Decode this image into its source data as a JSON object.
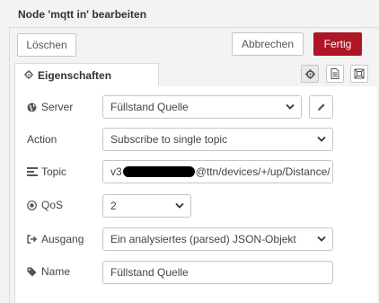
{
  "window": {
    "title": "Node 'mqtt in' bearbeiten"
  },
  "toolbar": {
    "delete_label": "Löschen",
    "cancel_label": "Abbrechen",
    "done_label": "Fertig"
  },
  "tabs": {
    "properties_label": "Eigenschaften",
    "icons": [
      "gear-icon",
      "document-icon",
      "frame-icon"
    ]
  },
  "form": {
    "server": {
      "label": "Server",
      "value": "Füllstand Quelle"
    },
    "action": {
      "label": "Action",
      "value": "Subscribe to single topic"
    },
    "topic": {
      "label": "Topic",
      "value_prefix": "v3",
      "value_suffix": "@ttn/devices/+/up/Distance/"
    },
    "qos": {
      "label": "QoS",
      "value": "2"
    },
    "output": {
      "label": "Ausgang",
      "value": "Ein analysiertes (parsed) JSON-Objekt"
    },
    "name": {
      "label": "Name",
      "value": "Füllstand Quelle"
    }
  },
  "colors": {
    "primary_button": "#ad1625",
    "border": "#c6c6c6",
    "background": "#f3f3f3"
  }
}
